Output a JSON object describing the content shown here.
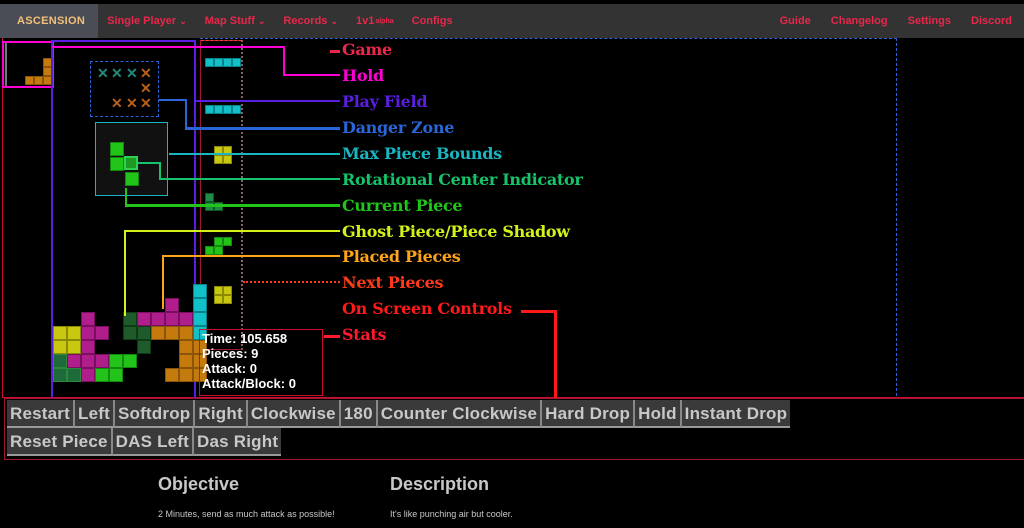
{
  "nav": {
    "brand": "ASCENSION",
    "left_items": [
      {
        "label": "Single Player",
        "dropdown": true
      },
      {
        "label": "Map Stuff",
        "dropdown": true
      },
      {
        "label": "Records",
        "dropdown": true
      },
      {
        "label": "1v1",
        "sup": "alpha",
        "dropdown": false
      },
      {
        "label": "Configs",
        "dropdown": false
      }
    ],
    "right_items": [
      "Guide",
      "Changelog",
      "Settings",
      "Discord"
    ],
    "chevron_glyph": "⌄"
  },
  "colors": {
    "game": "#e8274b",
    "hold": "#ff00d4",
    "play_field": "#5a1ee0",
    "danger_zone": "#2a66d8",
    "max_piece_bounds": "#1ab5c0",
    "rotational_center": "#15c46a",
    "current_piece": "#22c41a",
    "ghost_piece": "#d4f21a",
    "placed_pieces": "#ffa319",
    "next_pieces": "#ff3a1a",
    "on_screen_controls": "#ff1a1a",
    "stats": "#ff1a2e"
  },
  "legend": [
    {
      "key": "game",
      "label": "Game"
    },
    {
      "key": "hold",
      "label": "Hold"
    },
    {
      "key": "play_field",
      "label": "Play Field"
    },
    {
      "key": "danger_zone",
      "label": "Danger Zone"
    },
    {
      "key": "max_piece_bounds",
      "label": "Max Piece Bounds"
    },
    {
      "key": "rotational_center",
      "label": "Rotational Center Indicator"
    },
    {
      "key": "current_piece",
      "label": "Current Piece"
    },
    {
      "key": "ghost_piece",
      "label": "Ghost Piece/Piece Shadow"
    },
    {
      "key": "placed_pieces",
      "label": "Placed Pieces"
    },
    {
      "key": "next_pieces",
      "label": "Next Pieces"
    },
    {
      "key": "on_screen_controls",
      "label": "On Screen Controls"
    },
    {
      "key": "stats",
      "label": "Stats"
    }
  ],
  "hold_piece": "L",
  "next_queue": [
    "I",
    "I",
    "O",
    "S",
    "S",
    "O"
  ],
  "stats": {
    "time_label": "Time:",
    "time": "105.658",
    "pieces_label": "Pieces:",
    "pieces": "9",
    "attack_label": "Attack:",
    "attack": "0",
    "apb_label": "Attack/Block:",
    "apb": "0"
  },
  "controls": {
    "row1": [
      "Restart",
      "Left",
      "Softdrop",
      "Right",
      "Clockwise",
      "180",
      "Counter Clockwise",
      "Hard Drop",
      "Hold",
      "Instant Drop"
    ],
    "row2": [
      "Reset Piece",
      "DAS Left",
      "Das Right"
    ]
  },
  "info": {
    "objective_title": "Objective",
    "objective_text": "2 Minutes, send as much attack as possible!",
    "description_title": "Description",
    "description_text": "It's like punching air but cooler."
  }
}
